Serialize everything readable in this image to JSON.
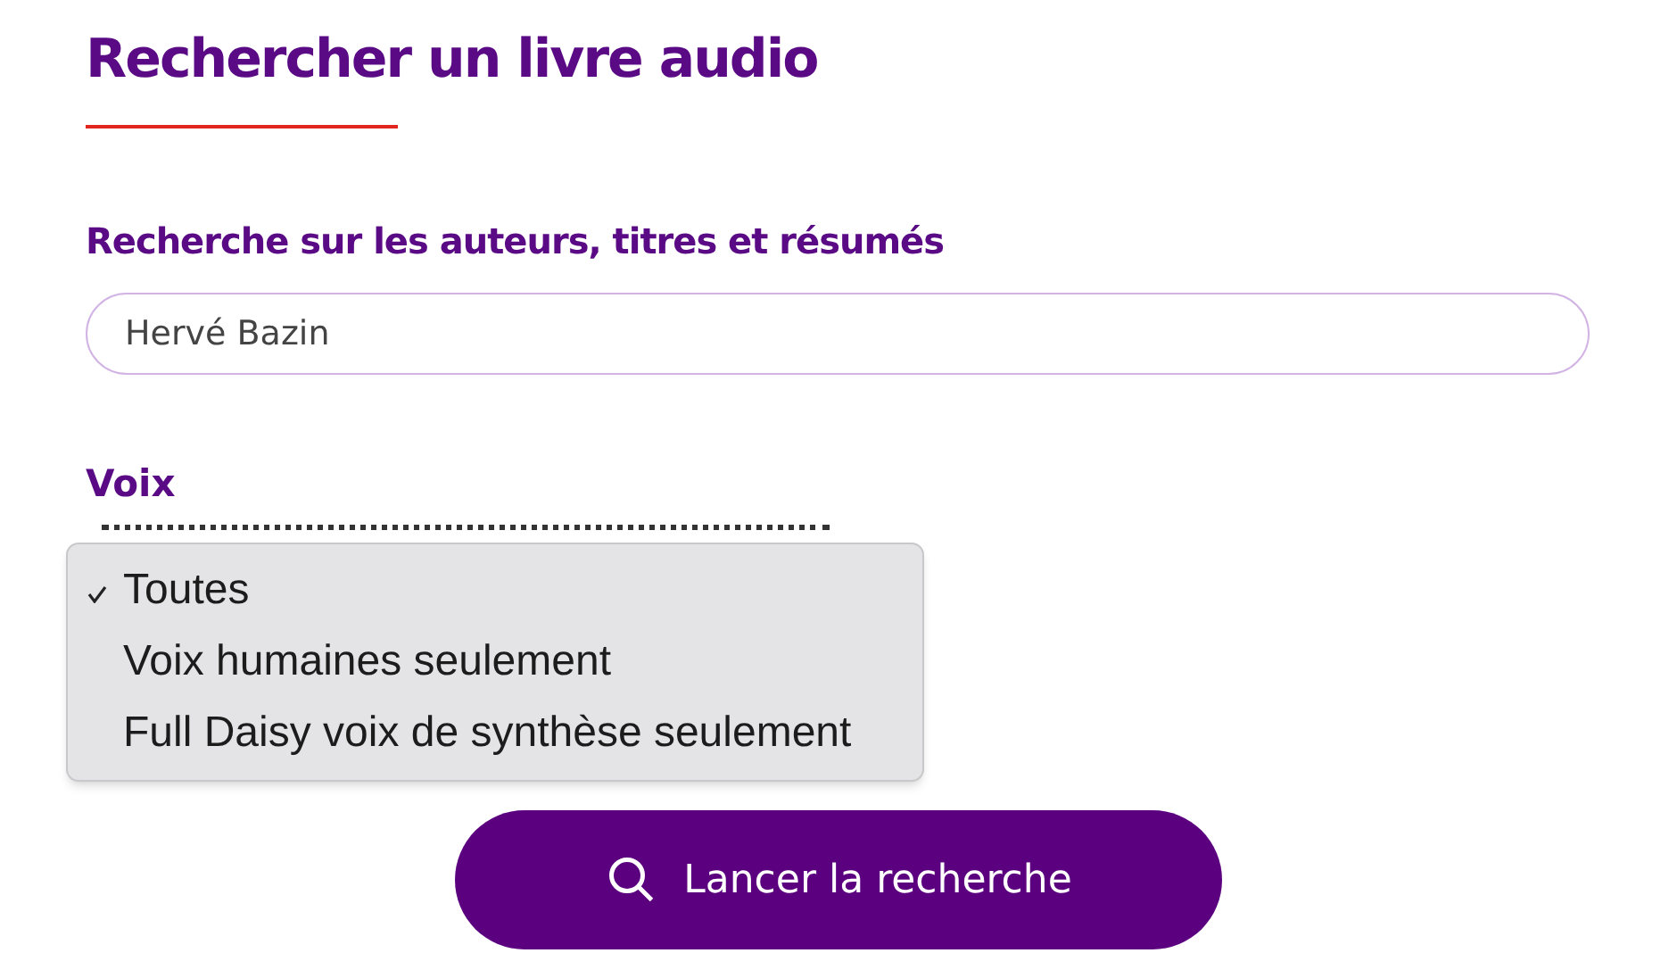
{
  "title": "Rechercher un livre audio",
  "search": {
    "label": "Recherche sur les auteurs, titres et résumés",
    "value": "Hervé Bazin"
  },
  "voice": {
    "label": "Voix",
    "expanded": true,
    "options": [
      {
        "label": "Toutes",
        "selected": true
      },
      {
        "label": "Voix humaines seulement",
        "selected": false
      },
      {
        "label": "Full Daisy voix de synthèse seulement",
        "selected": false
      }
    ]
  },
  "submit": {
    "label": "Lancer la recherche"
  }
}
